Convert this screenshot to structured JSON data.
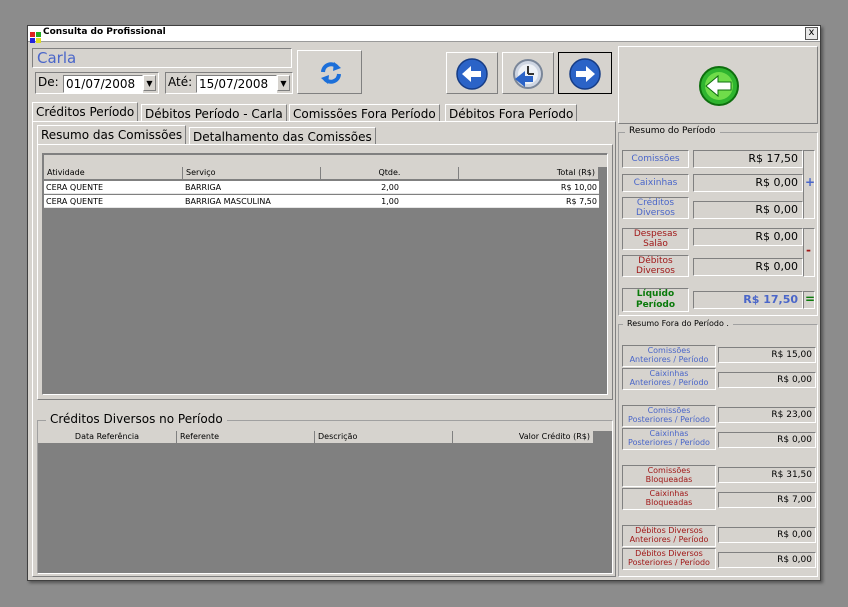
{
  "window": {
    "title": "Consulta do Profissional",
    "close_glyph": "x"
  },
  "professional": {
    "name": "Carla"
  },
  "filter": {
    "from_label": "De:",
    "from_value": "01/07/2008",
    "to_label": "Até:",
    "to_value": "15/07/2008"
  },
  "tabs": [
    {
      "label": "Créditos Período",
      "active": true
    },
    {
      "label": "Débitos Período - Carla",
      "active": false
    },
    {
      "label": "Comissões Fora Período",
      "active": false
    },
    {
      "label": "Débitos Fora Período",
      "active": false
    }
  ],
  "subtabs": [
    {
      "label": "Resumo das Comissões",
      "active": true
    },
    {
      "label": "Detalhamento das Comissões",
      "active": false
    }
  ],
  "commissions_table": {
    "columns": [
      "Atividade",
      "Serviço",
      "Qtde.",
      "Total (R$)"
    ],
    "rows": [
      [
        "CERA QUENTE",
        "BARRIGA",
        "2,00",
        "R$ 10,00"
      ],
      [
        "CERA QUENTE",
        "BARRIGA MASCULINA",
        "1,00",
        "R$ 7,50"
      ]
    ]
  },
  "credits_section": {
    "title": "Créditos Diversos no Período",
    "columns": [
      "Data Referência",
      "Referente",
      "Descrição",
      "Valor Crédito (R$)"
    ]
  },
  "summary": {
    "title": "Resumo do Período",
    "comissoes": {
      "label": "Comissões",
      "value": "R$ 17,50"
    },
    "caixinhas": {
      "label": "Caixinhas",
      "value": "R$ 0,00"
    },
    "creditos_diversos": {
      "label1": "Créditos",
      "label2": "Diversos",
      "value": "R$ 0,00"
    },
    "despesas_salao": {
      "label1": "Despesas",
      "label2": "Salão",
      "value": "R$ 0,00"
    },
    "debitos_diversos": {
      "label1": "Débitos",
      "label2": "Diversos",
      "value": "R$ 0,00"
    },
    "liquido": {
      "label1": "Líquido",
      "label2": "Período",
      "value": "R$ 17,50"
    },
    "plus_sign": "+",
    "minus_sign": "-",
    "equals_sign": "="
  },
  "outside_summary": {
    "title": "Resumo Fora do Período  .",
    "items": [
      {
        "label1": "Comissões",
        "label2": "Anteriores / Período",
        "value": "R$ 15,00",
        "color": "blue"
      },
      {
        "label1": "Caixinhas",
        "label2": "Anteriores / Período",
        "value": "R$ 0,00",
        "color": "blue"
      },
      {
        "label1": "Comissões",
        "label2": "Posteriores / Período",
        "value": "R$ 23,00",
        "color": "blue"
      },
      {
        "label1": "Caixinhas",
        "label2": "Posteriores / Período",
        "value": "R$ 0,00",
        "color": "blue"
      },
      {
        "label1": "Comissões",
        "label2": "Bloqueadas",
        "value": "R$ 31,50",
        "color": "red"
      },
      {
        "label1": "Caixinhas",
        "label2": "Bloqueadas",
        "value": "R$ 7,00",
        "color": "red"
      },
      {
        "label1": "Débitos Diversos",
        "label2": "Anteriores / Período",
        "value": "R$ 0,00",
        "color": "red"
      },
      {
        "label1": "Débitos Diversos",
        "label2": "Posteriores / Período",
        "value": "R$ 0,00",
        "color": "red"
      }
    ]
  },
  "icons": {
    "refresh": "refresh-icon",
    "back": "arrow-left-icon",
    "clock": "clock-icon",
    "forward": "arrow-right-icon",
    "exit": "exit-arrow-icon"
  },
  "colors": {
    "accent_blue": "#4a66c9",
    "debit_red": "#a01818",
    "net_green": "#0a7a0a"
  }
}
